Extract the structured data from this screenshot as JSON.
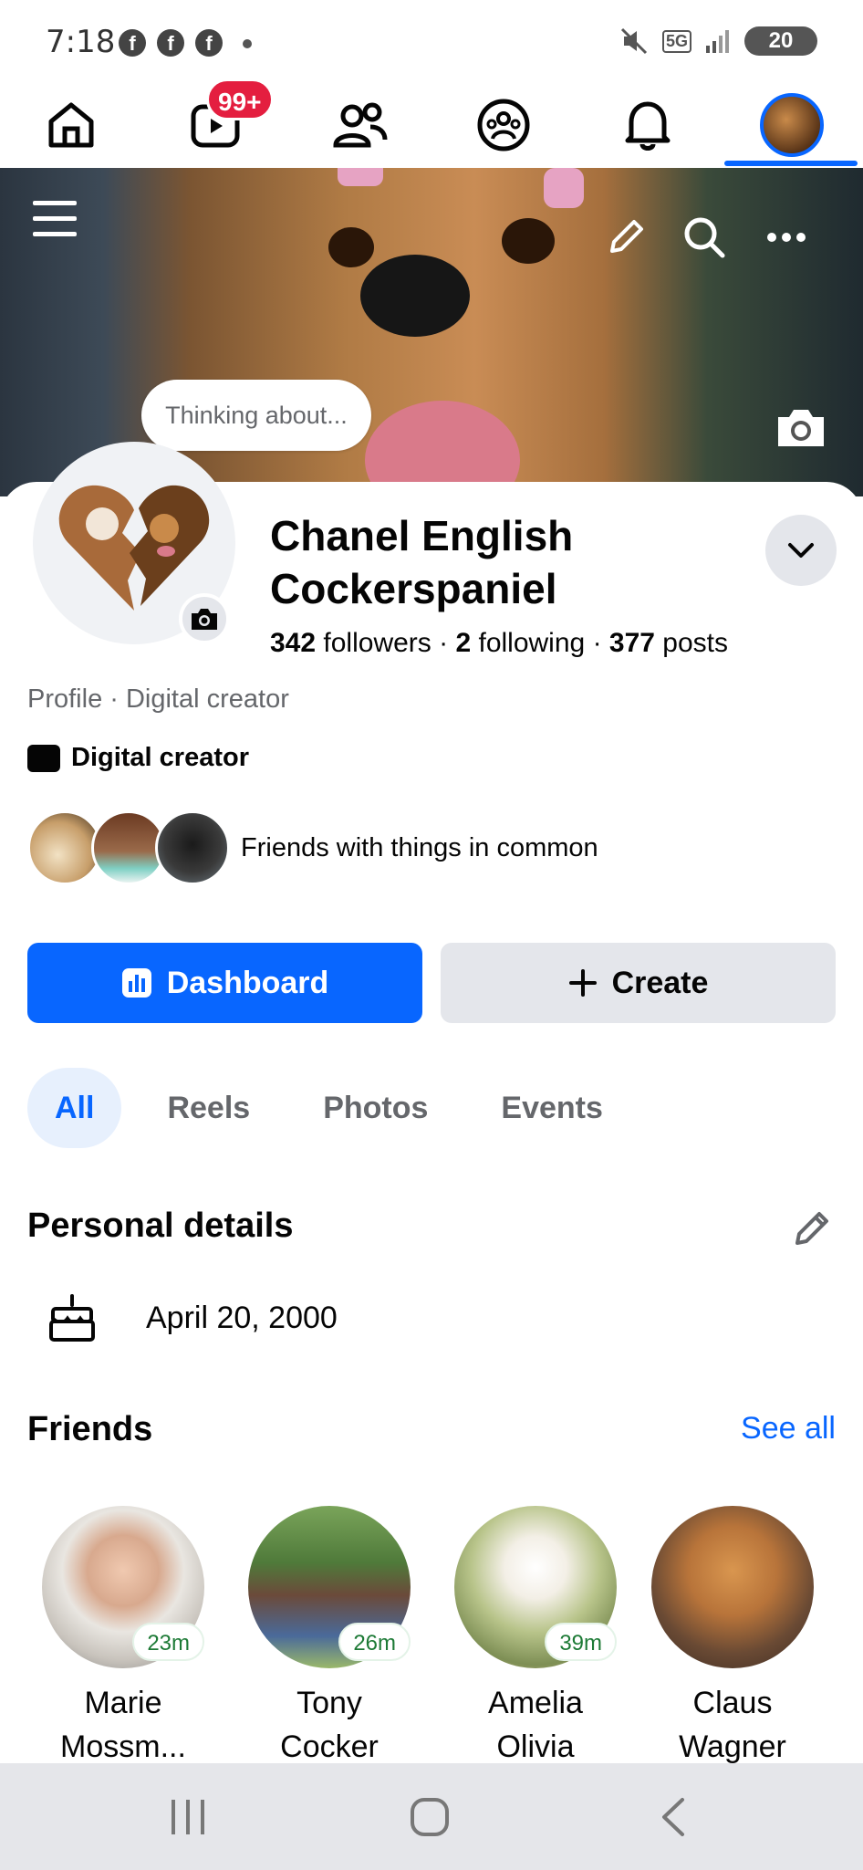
{
  "status_bar": {
    "time": "7:18",
    "fb_notifications": [
      "f",
      "f",
      "f"
    ],
    "network": "5G",
    "battery": "20"
  },
  "top_nav": {
    "items": [
      "home-icon",
      "video-icon",
      "friends-icon",
      "groups-icon",
      "bell-icon",
      "profile-avatar"
    ],
    "video_badge": "99+",
    "accent_color": "#0866ff"
  },
  "cover": {
    "thought_bubble": "Thinking about..."
  },
  "profile": {
    "name": "Chanel English Cockerspaniel",
    "followers_count": "342",
    "followers_label": "followers",
    "following_count": "2",
    "following_label": "following",
    "posts_count": "377",
    "posts_label": "posts",
    "subtitle": "Profile · Digital creator",
    "category": "Digital creator",
    "friends_in_common": "Friends with things in common"
  },
  "actions": {
    "dashboard": "Dashboard",
    "create": "Create"
  },
  "tabs": [
    "All",
    "Reels",
    "Photos",
    "Events"
  ],
  "personal_details": {
    "title": "Personal details",
    "birthday": "April 20, 2000"
  },
  "friends": {
    "title": "Friends",
    "see_all": "See all",
    "list": [
      {
        "name_line1": "Marie",
        "name_line2": "Mossm...",
        "time": "23m"
      },
      {
        "name_line1": "Tony",
        "name_line2": "Cocker",
        "time": "26m"
      },
      {
        "name_line1": "Amelia",
        "name_line2": "Olivia",
        "time": "39m"
      },
      {
        "name_line1": "Claus",
        "name_line2": "Wagner",
        "time": ""
      }
    ]
  }
}
